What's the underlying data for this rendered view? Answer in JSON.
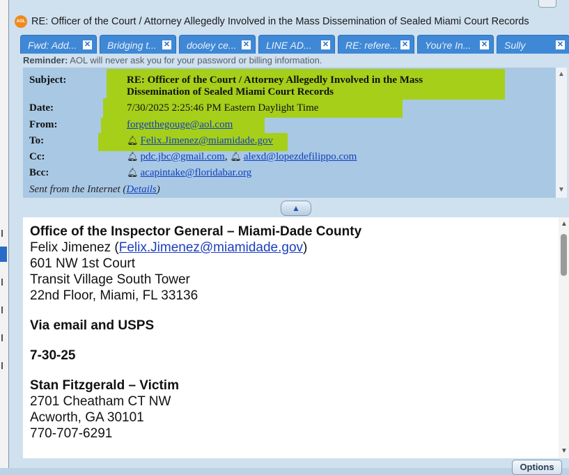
{
  "window": {
    "title": "RE: Officer of the Court / Attorney Allegedly Involved in the Mass Dissemination of Sealed Miami Court Records",
    "logo_text": "AOL"
  },
  "tabs": [
    {
      "label": "Fwd: Add..."
    },
    {
      "label": "Bridging t..."
    },
    {
      "label": "dooley ce..."
    },
    {
      "label": "LINE AD..."
    },
    {
      "label": "RE: refere..."
    },
    {
      "label": "You're In..."
    },
    {
      "label": "Sully"
    }
  ],
  "reminder": {
    "label": "Reminder:",
    "text": " AOL will never ask you for your password or billing information."
  },
  "header": {
    "subject_label": "Subject:",
    "subject_line1": "RE: Officer of the Court / Attorney Allegedly Involved in the Mass",
    "subject_line2": "Dissemination of Sealed Miami Court Records",
    "date_label": "Date:",
    "date": "7/30/2025 2:25:46 PM Eastern Daylight Time",
    "from_label": "From:",
    "from": "forgetthegouge@aol.com",
    "to_label": "To:",
    "to": "Felix.Jimenez@miamidade.gov",
    "cc_label": "Cc:",
    "cc1": "pdc.jbc@gmail.com",
    "cc_sep": ",",
    "cc2": "alexd@lopezdefilippo.com",
    "bcc_label": "Bcc:",
    "bcc": "acapintake@floridabar.org",
    "sent_prefix": "Sent from the Internet (",
    "details_link": "Details",
    "sent_suffix": ")"
  },
  "body": {
    "line1": "Office of the Inspector General – Miami-Dade County",
    "line2_prefix": "Felix Jimenez (",
    "line2_email": "Felix.Jimenez@miamidade.gov",
    "line2_suffix": ")",
    "line3": "601 NW 1st Court",
    "line4": "Transit Village South Tower",
    "line5": "22nd Floor, Miami, FL 33136",
    "line6": "Via email and USPS",
    "line7": "7-30-25",
    "line8": "Stan Fitzgerald – Victim",
    "line9": "2701 Cheatham CT NW",
    "line10": "Acworth, GA 30101",
    "line11": "770-707-6291"
  },
  "buttons": {
    "options": "Options",
    "collapse": "▲"
  },
  "icons": {
    "bell": "🔔︎",
    "close": "✕",
    "up": "▲",
    "down": "▼"
  },
  "colors": {
    "highlight": "#a6cf1a",
    "tab": "#3f88d6",
    "header_bg": "#a9c8e4",
    "link": "#1040c0"
  }
}
